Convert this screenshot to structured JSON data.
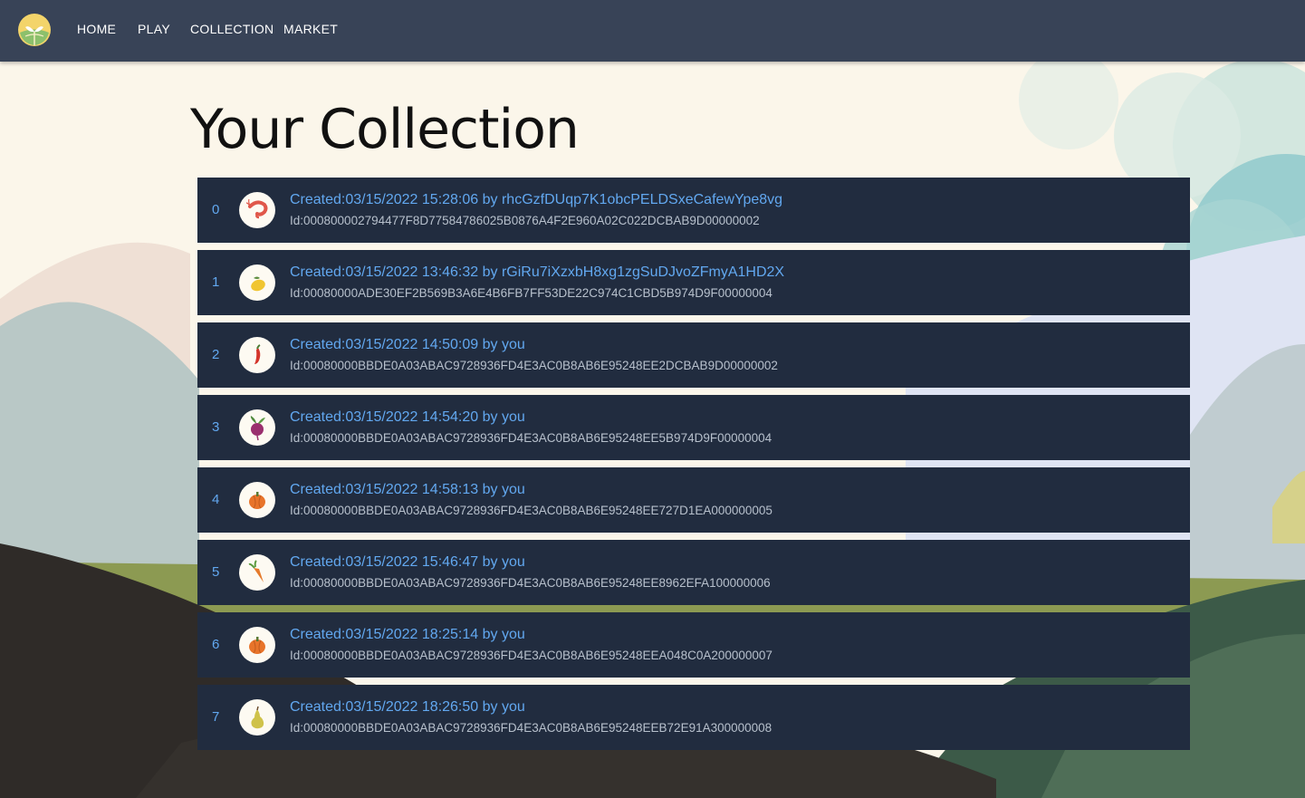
{
  "nav": {
    "links": [
      "HOME",
      "PLAY",
      "COLLECTION",
      "MARKET"
    ]
  },
  "page": {
    "title": "Your Collection"
  },
  "items": [
    {
      "index": "0",
      "title": "Created:03/15/2022 15:28:06 by rhcGzfDUqp7K1obcPELDSxeCafewYpe8vg",
      "id": "Id:000800002794477F8D77584786025B0876A4F2E960A02C022DCBAB9D00000002",
      "icon": "shrimp-icon"
    },
    {
      "index": "1",
      "title": "Created:03/15/2022 13:46:32 by rGiRu7iXzxbH8xg1zgSuDJvoZFmyA1HD2X",
      "id": "Id:00080000ADE30EF2B569B3A6E4B6FB7FF53DE22C974C1CBD5B974D9F00000004",
      "icon": "lemon-icon"
    },
    {
      "index": "2",
      "title": "Created:03/15/2022 14:50:09 by you",
      "id": "Id:00080000BBDE0A03ABAC9728936FD4E3AC0B8AB6E95248EE2DCBAB9D00000002",
      "icon": "chili-pepper-icon"
    },
    {
      "index": "3",
      "title": "Created:03/15/2022 14:54:20 by you",
      "id": "Id:00080000BBDE0A03ABAC9728936FD4E3AC0B8AB6E95248EE5B974D9F00000004",
      "icon": "beet-icon"
    },
    {
      "index": "4",
      "title": "Created:03/15/2022 14:58:13 by you",
      "id": "Id:00080000BBDE0A03ABAC9728936FD4E3AC0B8AB6E95248EE727D1EA000000005",
      "icon": "pumpkin-icon"
    },
    {
      "index": "5",
      "title": "Created:03/15/2022 15:46:47 by you",
      "id": "Id:00080000BBDE0A03ABAC9728936FD4E3AC0B8AB6E95248EE8962EFA100000006",
      "icon": "carrot-icon"
    },
    {
      "index": "6",
      "title": "Created:03/15/2022 18:25:14 by you",
      "id": "Id:00080000BBDE0A03ABAC9728936FD4E3AC0B8AB6E95248EEA048C0A200000007",
      "icon": "pumpkin-icon"
    },
    {
      "index": "7",
      "title": "Created:03/15/2022 18:26:50 by you",
      "id": "Id:00080000BBDE0A03ABAC9728936FD4E3AC0B8AB6E95248EEB72E91A300000008",
      "icon": "pear-icon"
    }
  ],
  "colors": {
    "navbar": "#384357",
    "row_bg": "#212c3f",
    "accent": "#62a8f0",
    "id_text": "#b7c0cc"
  }
}
